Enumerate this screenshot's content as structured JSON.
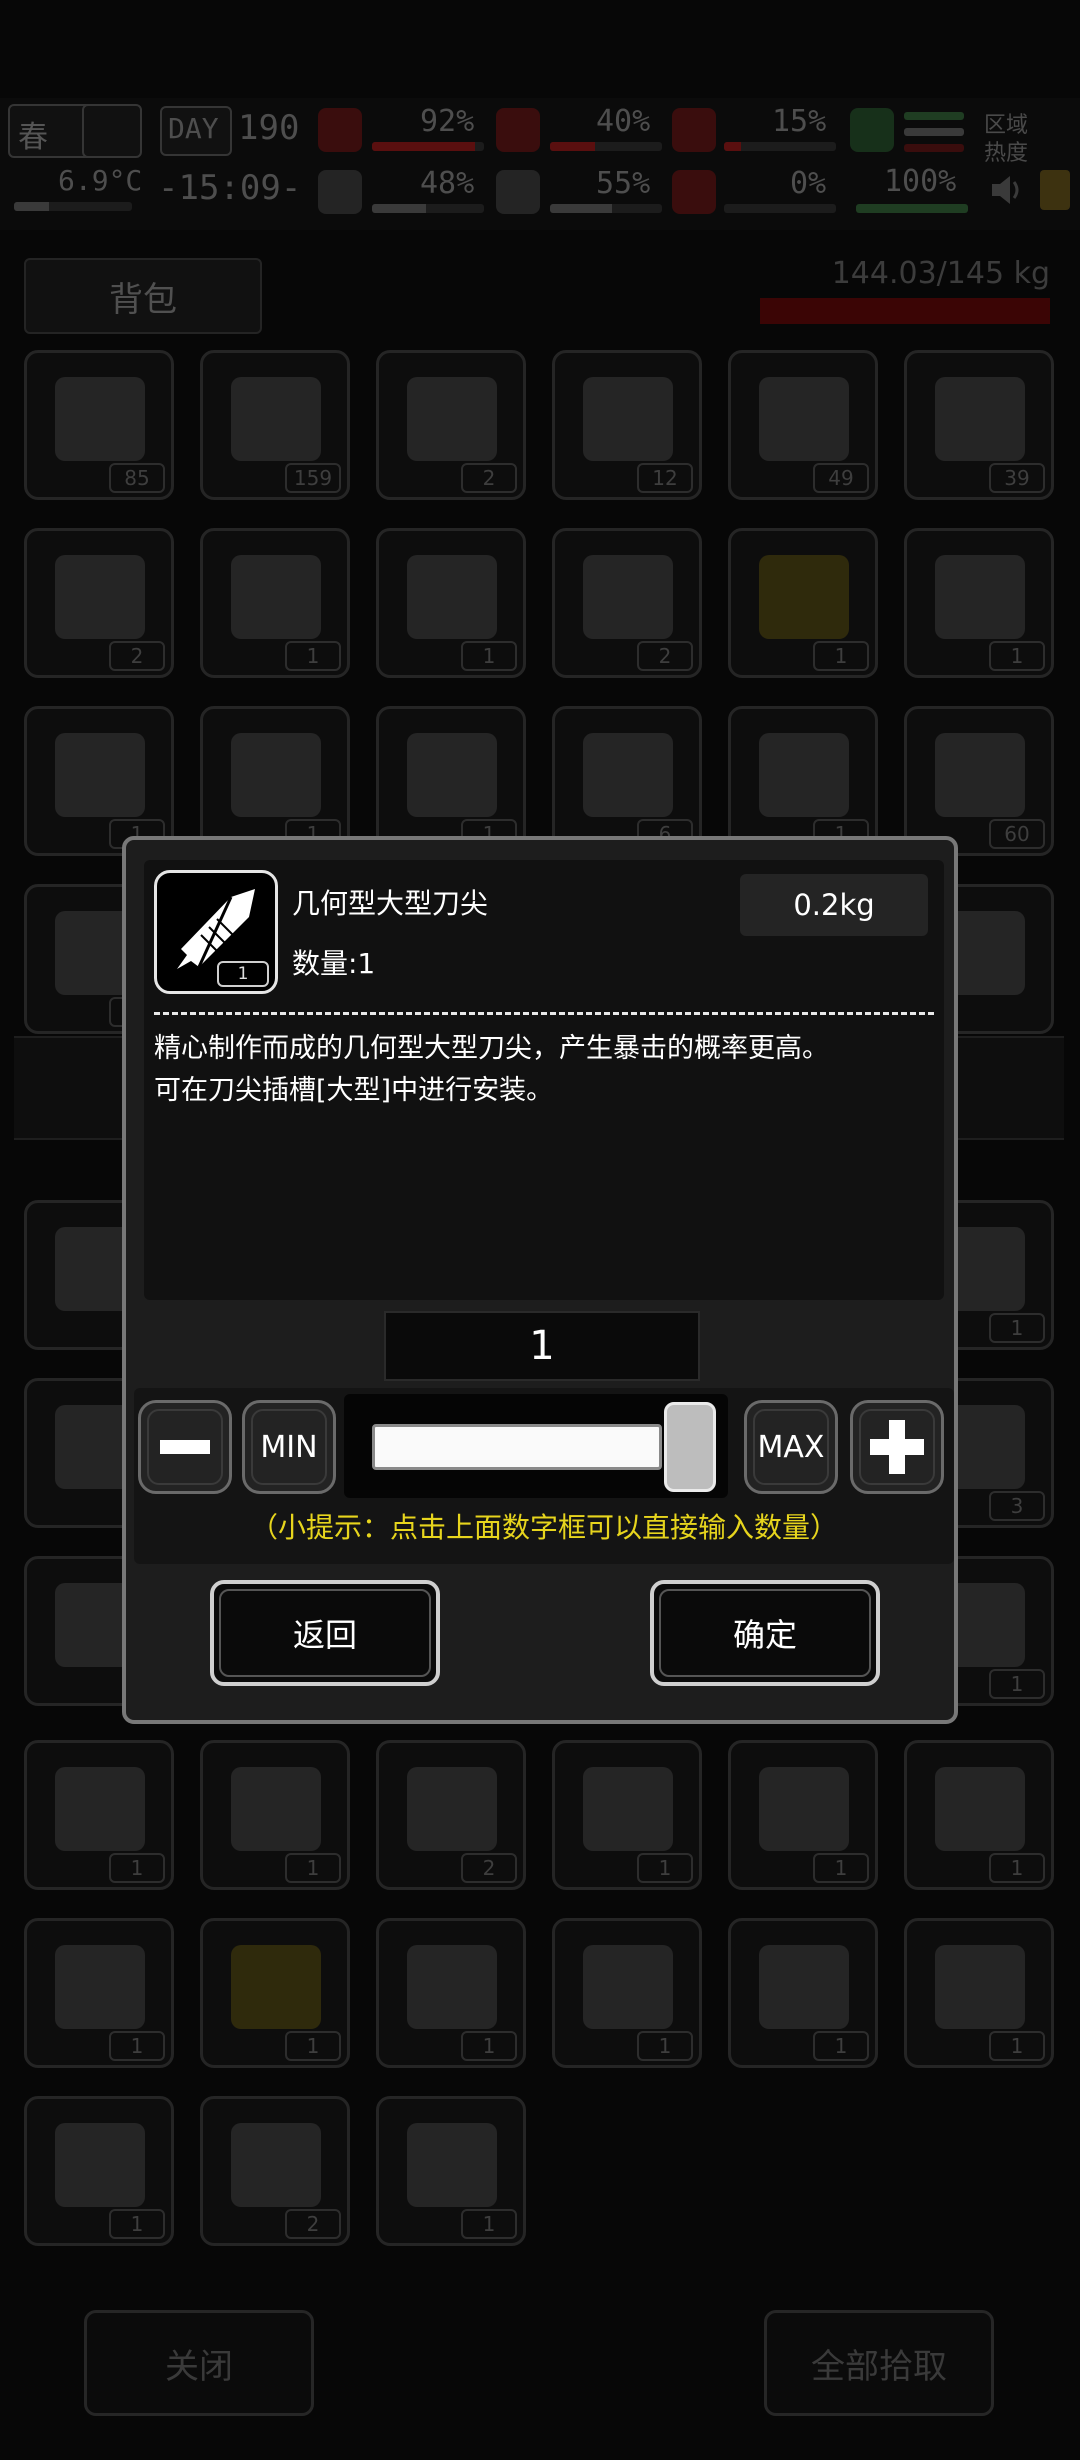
{
  "status_bar": {
    "season": "春",
    "day_label": "DAY",
    "day_number": "190",
    "temperature": "6.9°C",
    "time": "-15:09-",
    "stats": [
      {
        "value": "92%",
        "icon": "medkit-icon",
        "fill": 0.92,
        "color": "#5a0f0f"
      },
      {
        "value": "48%",
        "icon": "brain-icon",
        "fill": 0.48,
        "color": "#3a3a3a"
      },
      {
        "value": "40%",
        "icon": "stomach-icon",
        "fill": 0.4,
        "color": "#5a0f0f"
      },
      {
        "value": "55%",
        "icon": "water-drop-icon",
        "fill": 0.55,
        "color": "#3a3a3a"
      },
      {
        "value": "15%",
        "icon": "blood-icon",
        "fill": 0.15,
        "color": "#5a0f0f"
      },
      {
        "value": "0%",
        "icon": "heart-icon",
        "fill": 0.0,
        "color": "#5a0f0f"
      }
    ],
    "radiation_value": "100%",
    "zone_heat_label": "区域热度"
  },
  "backpack": {
    "tab_label": "背包",
    "weight": "144.03/145 kg",
    "slots": [
      {
        "qty": "85",
        "icon": "cloth-icon"
      },
      {
        "qty": "159",
        "icon": "beaker-icon"
      },
      {
        "qty": "2",
        "icon": "cloth-icon"
      },
      {
        "qty": "12",
        "icon": "cloth-icon"
      },
      {
        "qty": "49",
        "icon": "cloth-icon"
      },
      {
        "qty": "39",
        "icon": "ghillie-suit-icon"
      },
      {
        "qty": "2",
        "icon": "egg-icon"
      },
      {
        "qty": "1",
        "icon": "bullets-icon"
      },
      {
        "qty": "1",
        "icon": "bag-icon"
      },
      {
        "qty": "2",
        "icon": "tool-icon"
      },
      {
        "qty": "1",
        "icon": "axe-icon",
        "yellow": true
      },
      {
        "qty": "1",
        "icon": "blade-icon"
      },
      {
        "qty": "1",
        "icon": "spear-icon"
      },
      {
        "qty": "1",
        "icon": "knife-icon"
      },
      {
        "qty": "1",
        "icon": "sword-icon"
      },
      {
        "qty": "6",
        "icon": "rocket-icon"
      },
      {
        "qty": "1",
        "icon": "katana-icon"
      },
      {
        "qty": "60",
        "icon": "crate-icon"
      },
      {
        "qty": "1",
        "icon": "blade-icon"
      },
      {
        "qty": "",
        "icon": "empty-slot-icon"
      },
      {
        "qty": "",
        "icon": "empty-slot-icon"
      },
      {
        "qty": "",
        "icon": "empty-slot-icon"
      },
      {
        "qty": "",
        "icon": "empty-slot-icon"
      },
      {
        "qty": "",
        "icon": "empty-slot-icon"
      },
      {
        "qty": "",
        "icon": "gear-pile-icon"
      },
      {
        "qty": "",
        "icon": "empty-slot-icon"
      },
      {
        "qty": "",
        "icon": "empty-slot-icon"
      },
      {
        "qty": "",
        "icon": "empty-slot-icon"
      },
      {
        "qty": "",
        "icon": "empty-slot-icon"
      },
      {
        "qty": "1",
        "icon": "needle-icon"
      },
      {
        "qty": "",
        "icon": "empty-slot-icon"
      },
      {
        "qty": "",
        "icon": "empty-slot-icon"
      },
      {
        "qty": "",
        "icon": "empty-slot-icon"
      },
      {
        "qty": "",
        "icon": "empty-slot-icon"
      },
      {
        "qty": "",
        "icon": "empty-slot-icon"
      },
      {
        "qty": "3",
        "icon": "cloth-icon"
      },
      {
        "qty": "",
        "icon": "empty-slot-icon"
      },
      {
        "qty": "",
        "icon": "empty-slot-icon"
      },
      {
        "qty": "",
        "icon": "empty-slot-icon"
      },
      {
        "qty": "",
        "icon": "empty-slot-icon"
      },
      {
        "qty": "",
        "icon": "empty-slot-icon"
      },
      {
        "qty": "1",
        "icon": "knife-icon"
      },
      {
        "qty": "1",
        "icon": "dagger-icon"
      },
      {
        "qty": "1",
        "icon": "cleaver-icon"
      },
      {
        "qty": "2",
        "icon": "pellets-icon"
      },
      {
        "qty": "1",
        "icon": "blade-icon"
      },
      {
        "qty": "1",
        "icon": "helmet-icon"
      },
      {
        "qty": "1",
        "icon": "gas-mask-icon"
      },
      {
        "qty": "1",
        "icon": "bandage-icon"
      },
      {
        "qty": "1",
        "icon": "cloth-icon",
        "yellow": true
      },
      {
        "qty": "1",
        "icon": "machete-icon"
      },
      {
        "qty": "1",
        "icon": "kunai-icon"
      },
      {
        "qty": "1",
        "icon": "pipes-icon"
      },
      {
        "qty": "1",
        "icon": "seeds-icon"
      },
      {
        "qty": "1",
        "icon": "glove-icon"
      },
      {
        "qty": "2",
        "icon": "ingot-icon"
      },
      {
        "qty": "1",
        "icon": "blade-tip-icon"
      }
    ],
    "close_label": "关闭",
    "take_all_label": "全部拾取"
  },
  "dialog": {
    "item_icon": "large-blade-tip-icon",
    "item_icon_qty": "1",
    "item_name": "几何型大型刀尖",
    "item_count": "数量:1",
    "item_weight": "0.2kg",
    "description_lines": [
      "精心制作而成的几何型大型刀尖，产生暴击的概率更高。",
      "可在刀尖插槽[大型]中进行安装。"
    ],
    "quantity_value": "1",
    "slider_fraction": 1.0,
    "min_label": "MIN",
    "max_label": "MAX",
    "hint": "（小提示：点击上面数字框可以直接输入数量）",
    "back_label": "返回",
    "confirm_label": "确定"
  }
}
